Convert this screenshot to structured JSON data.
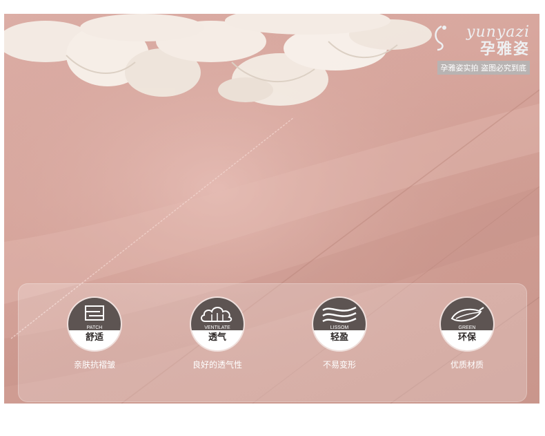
{
  "watermark": {
    "brand_latin": "yunyazi",
    "brand_cn": "孕雅姿",
    "notice": "孕雅姿实拍 盗图必究到底"
  },
  "features": [
    {
      "tag": "PATCH",
      "name": "舒适",
      "desc": "亲肤抗褶皱",
      "icon": "patch-icon"
    },
    {
      "tag": "VENTILATE",
      "name": "透气",
      "desc": "良好的透气性",
      "icon": "cloud-icon"
    },
    {
      "tag": "LISSOM",
      "name": "轻盈",
      "desc": "不易变形",
      "icon": "waves-icon"
    },
    {
      "tag": "GREEN",
      "name": "环保",
      "desc": "优质材质",
      "icon": "leaf-icon"
    }
  ],
  "colors": {
    "fabric": "#d6a59c",
    "badge_dark": "#5d5452",
    "badge_light": "#ffffff",
    "notice_bg": "#b8b3b2"
  }
}
